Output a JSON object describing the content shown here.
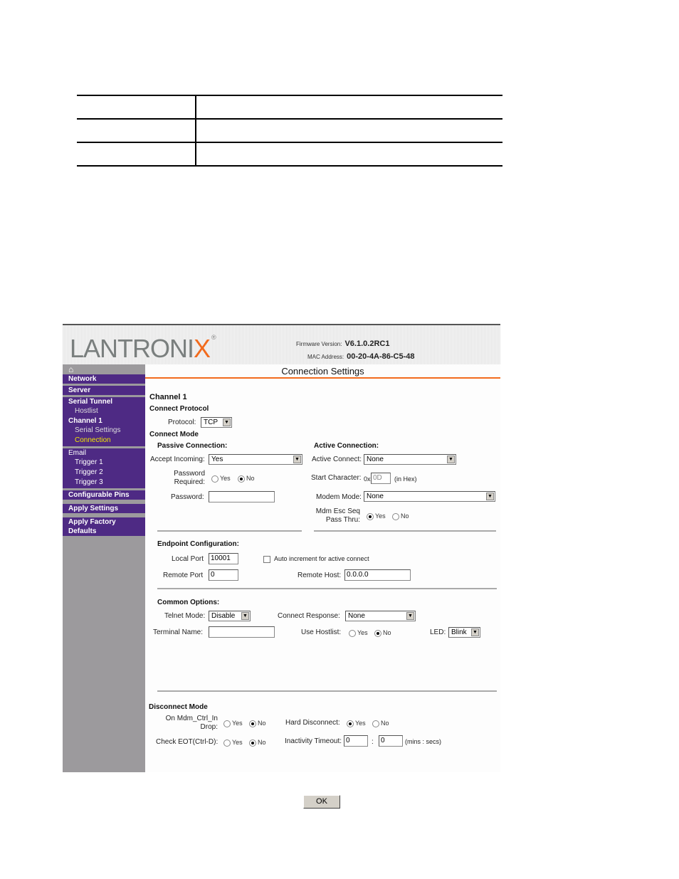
{
  "doc_table": {
    "rows": [
      [
        "",
        ""
      ],
      [
        "",
        ""
      ],
      [
        "",
        ""
      ]
    ]
  },
  "header": {
    "logo_main": "LANTRONI",
    "logo_x": "X",
    "logo_reg": "®",
    "firmware_label": "Firmware Version:",
    "firmware_value": "V6.1.0.2RC1",
    "mac_label": "MAC Address:",
    "mac_value": "00-20-4A-86-C5-48"
  },
  "sidebar": {
    "home_icon": "⌂",
    "items": {
      "network": "Network",
      "server": "Server",
      "serial_tunnel": "Serial Tunnel",
      "hostlist": "Hostlist",
      "channel1": "Channel 1",
      "serial_settings": "Serial Settings",
      "connection": "Connection",
      "email": "Email",
      "trigger1": "Trigger 1",
      "trigger2": "Trigger 2",
      "trigger3": "Trigger 3",
      "configurable_pins": "Configurable Pins",
      "apply_settings": "Apply Settings",
      "apply_factory_defaults": "Apply Factory Defaults"
    }
  },
  "main": {
    "title": "Connection Settings",
    "channel": "Channel 1",
    "connect_protocol": "Connect Protocol",
    "protocol_label": "Protocol:",
    "protocol_value": "TCP",
    "connect_mode": "Connect Mode",
    "passive": {
      "heading": "Passive Connection:",
      "accept_incoming_label": "Accept Incoming:",
      "accept_incoming_value": "Yes",
      "password_required_label_1": "Password",
      "password_required_label_2": "Required:",
      "password_required_value": "No",
      "password_label": "Password:",
      "password_value": ""
    },
    "active": {
      "heading": "Active Connection:",
      "active_connect_label": "Active Connect:",
      "active_connect_value": "None",
      "start_char_label": "Start Character:",
      "start_char_prefix": "0x",
      "start_char_value": "0D",
      "start_char_suffix": "(in Hex)",
      "modem_mode_label": "Modem Mode:",
      "modem_mode_value": "None",
      "esc_seq_label_1": "Mdm Esc Seq",
      "esc_seq_label_2": "Pass Thru:",
      "esc_seq_value": "Yes"
    },
    "endpoint": {
      "heading": "Endpoint Configuration:",
      "local_port_label": "Local Port",
      "local_port_value": "10001",
      "auto_increment_label": "Auto increment for active connect",
      "auto_increment_checked": false,
      "remote_port_label": "Remote Port",
      "remote_port_value": "0",
      "remote_host_label": "Remote Host:",
      "remote_host_value": "0.0.0.0"
    },
    "common": {
      "heading": "Common Options:",
      "telnet_mode_label": "Telnet Mode:",
      "telnet_mode_value": "Disable",
      "connect_response_label": "Connect Response:",
      "connect_response_value": "None",
      "terminal_name_label": "Terminal Name:",
      "terminal_name_value": "",
      "use_hostlist_label": "Use Hostlist:",
      "use_hostlist_value": "No",
      "led_label": "LED:",
      "led_value": "Blink"
    },
    "disconnect": {
      "heading": "Disconnect Mode",
      "mdm_ctrl_label_1": "On Mdm_Ctrl_In",
      "mdm_ctrl_label_2": "Drop:",
      "mdm_ctrl_value": "No",
      "hard_disconnect_label": "Hard Disconnect:",
      "hard_disconnect_value": "Yes",
      "check_eot_label": "Check EOT(Ctrl-D):",
      "check_eot_value": "No",
      "inactivity_label": "Inactivity Timeout:",
      "inactivity_mins": "0",
      "inactivity_sep": ":",
      "inactivity_secs": "0",
      "inactivity_units": "(mins : secs)"
    },
    "yes": "Yes",
    "no": "No",
    "ok_label": "OK"
  }
}
